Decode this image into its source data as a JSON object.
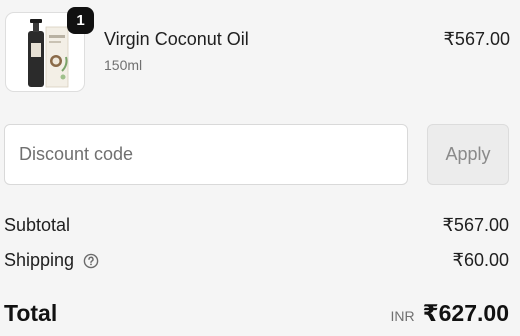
{
  "line_item": {
    "quantity": "1",
    "name": "Virgin Coconut Oil",
    "variant": "150ml",
    "price": "₹567.00",
    "image_icon": "product-bottle-icon"
  },
  "discount": {
    "placeholder": "Discount code",
    "value": "",
    "apply_label": "Apply"
  },
  "summary": {
    "subtotal_label": "Subtotal",
    "subtotal_value": "₹567.00",
    "shipping_label": "Shipping",
    "shipping_help_icon": "question-circle-icon",
    "shipping_value": "₹60.00",
    "total_label": "Total",
    "currency": "INR",
    "total_value": "₹627.00"
  },
  "colors": {
    "background": "#f5f5f5",
    "text": "#1f1f1f",
    "muted": "#707070",
    "badge": "#111111"
  }
}
